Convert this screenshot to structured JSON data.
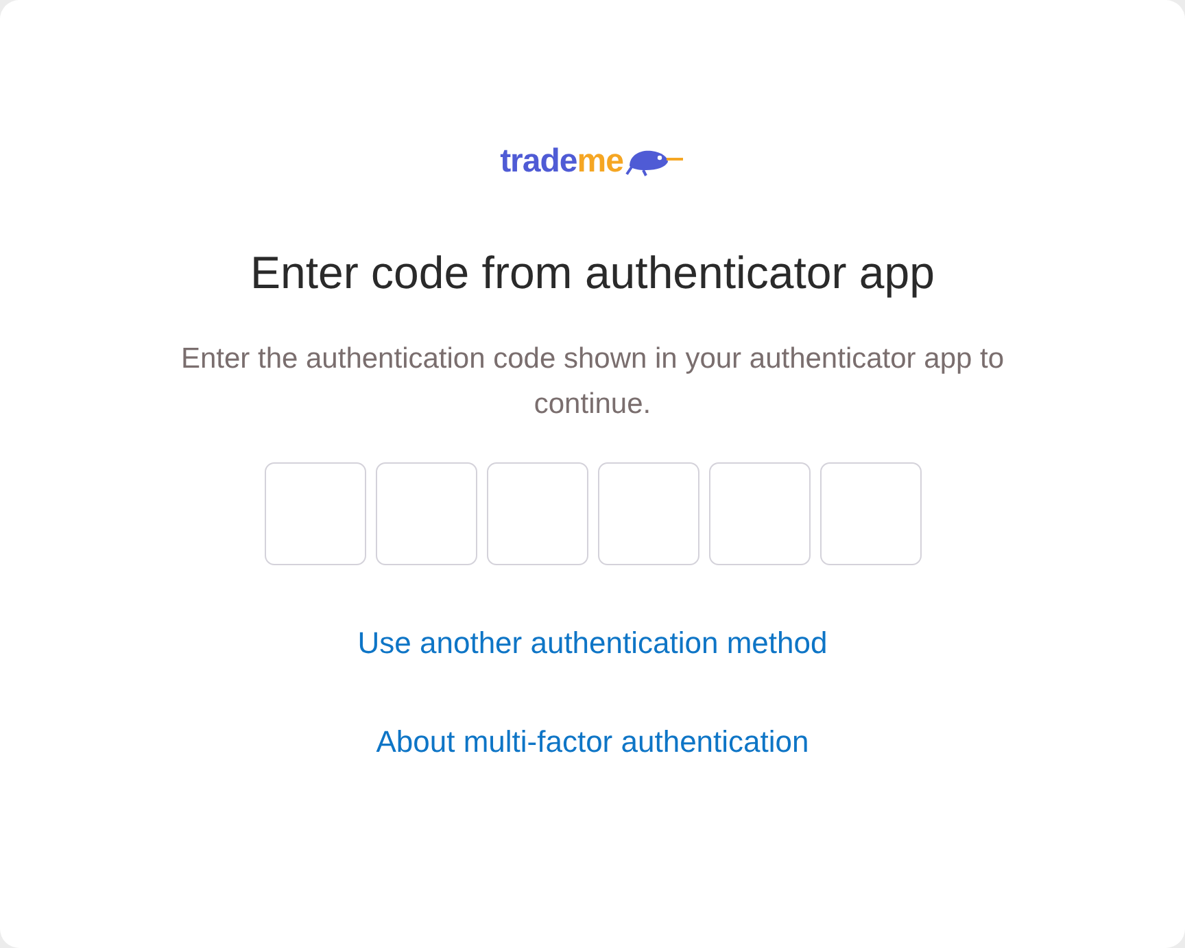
{
  "logo": {
    "parts": [
      {
        "text": "trade",
        "color": "#4f5bd5"
      },
      {
        "text": "me",
        "color": "#f5a623"
      }
    ]
  },
  "title": "Enter code from authenticator app",
  "description": "Enter the authentication code shown in your authenticator app to continue.",
  "code_inputs": [
    {
      "kind": "digit"
    },
    {
      "kind": "digit"
    },
    {
      "kind": "digit"
    },
    {
      "kind": "digit"
    },
    {
      "kind": "digit"
    },
    {
      "kind": "digit"
    }
  ],
  "links": [
    "Use another authentication method",
    "About multi-factor authentication"
  ]
}
